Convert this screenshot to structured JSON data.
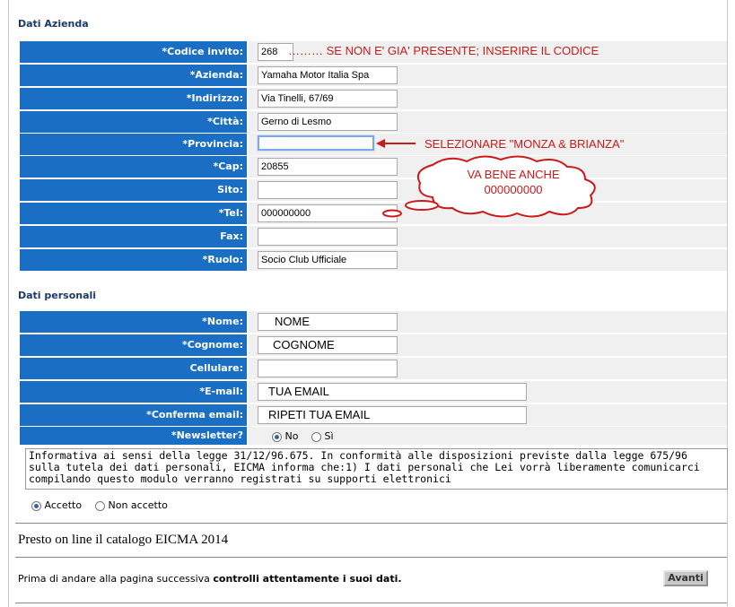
{
  "company": {
    "title": "Dati Azienda",
    "fields": [
      {
        "label": "*Codice invito:",
        "value": "268",
        "annotation": "……… SE NON E' GIA' PRESENTE; INSERIRE IL CODICE"
      },
      {
        "label": "*Azienda:",
        "value": "Yamaha Motor Italia Spa"
      },
      {
        "label": "*Indirizzo:",
        "value": "Via Tinelli, 67/69"
      },
      {
        "label": "*Città:",
        "value": "Gerno di Lesmo"
      },
      {
        "label": "*Provincia:",
        "value": "",
        "annotation": "SELEZIONARE \"MONZA & BRIANZA\""
      },
      {
        "label": "*Cap:",
        "value": "20855"
      },
      {
        "label": "Sito:",
        "value": ""
      },
      {
        "label": "*Tel:",
        "value": "000000000"
      },
      {
        "label": "Fax:",
        "value": ""
      },
      {
        "label": "*Ruolo:",
        "value": "Socio Club Ufficiale"
      }
    ],
    "bubble": {
      "line1": "VA BENE ANCHE",
      "line2": "000000000"
    }
  },
  "personal": {
    "title": "Dati personali",
    "fields": [
      {
        "label": "*Nome:",
        "value": "NOME"
      },
      {
        "label": "*Cognome:",
        "value": "COGNOME"
      },
      {
        "label": "Cellulare:",
        "value": ""
      },
      {
        "label": "*E-mail:",
        "value": "TUA EMAIL"
      },
      {
        "label": "*Conferma email:",
        "value": "RIPETI TUA EMAIL"
      }
    ],
    "newsletter": {
      "label": "*Newsletter?",
      "no": "No",
      "yes": "Sì",
      "selected": "No"
    }
  },
  "privacy": {
    "text": "Informativa ai sensi della legge 31/12/96.675. In conformità alle disposizioni previste dalla legge 675/96 sulla tutela dei dati personali, EICMA informa che:1) I dati personali che Lei vorrà liberamente comunicarci compilando questo modulo verranno registrati su supporti elettronici",
    "accept": "Accetto",
    "decline": "Non accetto",
    "selected": "Accetto"
  },
  "catalog_notice": "Presto on line il catalogo EICMA 2014",
  "footer": {
    "text_before": "Prima di andare alla pagina successiva ",
    "text_bold": "controlli attentamente i suoi dati.",
    "next_button": "Avanti"
  },
  "colors": {
    "label_bg": "#1a6fc4",
    "annotation": "#cc1a1a",
    "title": "#1a3a6b"
  }
}
